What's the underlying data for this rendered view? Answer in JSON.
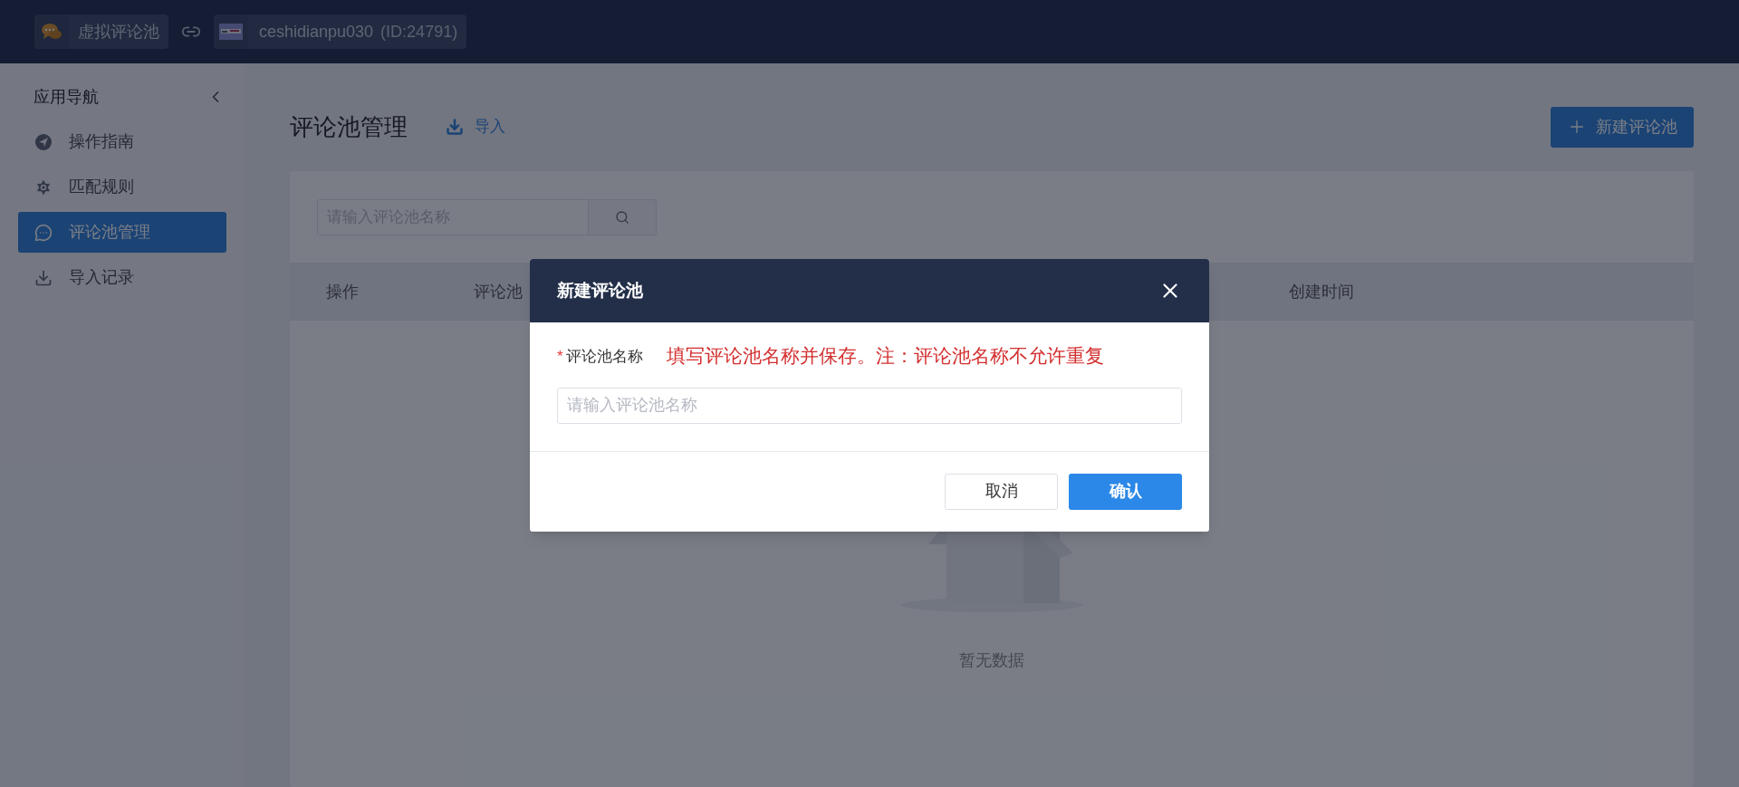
{
  "top_bar": {
    "app_chip": {
      "label": "虚拟评论池"
    },
    "shop_chip": {
      "name": "ceshidianpu030",
      "id": "(ID:24791)"
    }
  },
  "sidebar": {
    "title": "应用导航",
    "items": [
      {
        "kind": "guide",
        "label": "操作指南",
        "selected": false
      },
      {
        "kind": "rules",
        "label": "匹配规则",
        "selected": false
      },
      {
        "kind": "comments",
        "label": "评论池管理",
        "selected": true
      },
      {
        "kind": "import",
        "label": "导入记录",
        "selected": false
      }
    ]
  },
  "page": {
    "title": "评论池管理",
    "import_link": "导入",
    "new_button": "新建评论池",
    "search": {
      "placeholder": "请输入评论池名称"
    },
    "table": {
      "columns": [
        "操作",
        "评论池",
        "创建时间"
      ]
    },
    "empty_text": "暂无数据"
  },
  "dialog": {
    "title": "新建评论池",
    "field_label": "评论池名称",
    "required_mark": "*",
    "hint": "填写评论池名称并保存。注：评论池名称不允许重复",
    "field": {
      "placeholder": "请输入评论池名称"
    },
    "buttons": [
      {
        "kind": "secondary",
        "label": "取消"
      },
      {
        "kind": "primary",
        "label": "确认"
      }
    ]
  }
}
